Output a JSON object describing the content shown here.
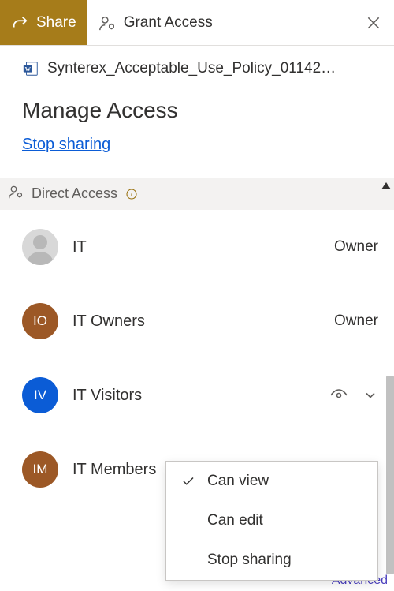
{
  "tabs": {
    "share": "Share",
    "grant": "Grant Access"
  },
  "file": {
    "name": "Synterex_Acceptable_Use_Policy_01142…"
  },
  "heading": "Manage Access",
  "stop_link": "Stop sharing",
  "section": {
    "title": "Direct Access"
  },
  "entities": [
    {
      "initials": "",
      "name": "IT",
      "role": "Owner",
      "avatar": "person"
    },
    {
      "initials": "IO",
      "name": "IT Owners",
      "role": "Owner",
      "avatar": "brown"
    },
    {
      "initials": "IV",
      "name": "IT Visitors",
      "role": "",
      "avatar": "blue",
      "dropdown": true
    },
    {
      "initials": "IM",
      "name": "IT Members",
      "role": "",
      "avatar": "brown"
    }
  ],
  "dropdown": {
    "can_view": "Can view",
    "can_edit": "Can edit",
    "stop": "Stop sharing"
  },
  "advanced": "Advanced"
}
